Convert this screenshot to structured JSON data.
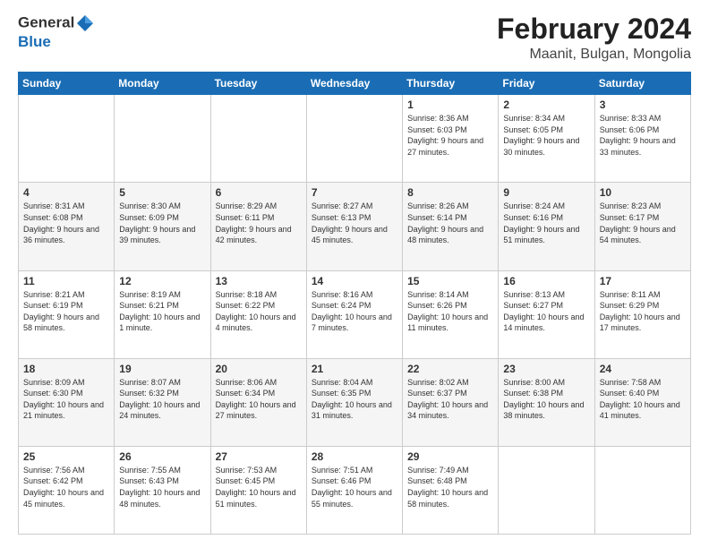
{
  "logo": {
    "line1": "General",
    "line2": "Blue"
  },
  "title": "February 2024",
  "subtitle": "Maanit, Bulgan, Mongolia",
  "days_header": [
    "Sunday",
    "Monday",
    "Tuesday",
    "Wednesday",
    "Thursday",
    "Friday",
    "Saturday"
  ],
  "weeks": [
    [
      {
        "day": "",
        "sunrise": "",
        "sunset": "",
        "daylight": ""
      },
      {
        "day": "",
        "sunrise": "",
        "sunset": "",
        "daylight": ""
      },
      {
        "day": "",
        "sunrise": "",
        "sunset": "",
        "daylight": ""
      },
      {
        "day": "",
        "sunrise": "",
        "sunset": "",
        "daylight": ""
      },
      {
        "day": "1",
        "sunrise": "Sunrise: 8:36 AM",
        "sunset": "Sunset: 6:03 PM",
        "daylight": "Daylight: 9 hours and 27 minutes."
      },
      {
        "day": "2",
        "sunrise": "Sunrise: 8:34 AM",
        "sunset": "Sunset: 6:05 PM",
        "daylight": "Daylight: 9 hours and 30 minutes."
      },
      {
        "day": "3",
        "sunrise": "Sunrise: 8:33 AM",
        "sunset": "Sunset: 6:06 PM",
        "daylight": "Daylight: 9 hours and 33 minutes."
      }
    ],
    [
      {
        "day": "4",
        "sunrise": "Sunrise: 8:31 AM",
        "sunset": "Sunset: 6:08 PM",
        "daylight": "Daylight: 9 hours and 36 minutes."
      },
      {
        "day": "5",
        "sunrise": "Sunrise: 8:30 AM",
        "sunset": "Sunset: 6:09 PM",
        "daylight": "Daylight: 9 hours and 39 minutes."
      },
      {
        "day": "6",
        "sunrise": "Sunrise: 8:29 AM",
        "sunset": "Sunset: 6:11 PM",
        "daylight": "Daylight: 9 hours and 42 minutes."
      },
      {
        "day": "7",
        "sunrise": "Sunrise: 8:27 AM",
        "sunset": "Sunset: 6:13 PM",
        "daylight": "Daylight: 9 hours and 45 minutes."
      },
      {
        "day": "8",
        "sunrise": "Sunrise: 8:26 AM",
        "sunset": "Sunset: 6:14 PM",
        "daylight": "Daylight: 9 hours and 48 minutes."
      },
      {
        "day": "9",
        "sunrise": "Sunrise: 8:24 AM",
        "sunset": "Sunset: 6:16 PM",
        "daylight": "Daylight: 9 hours and 51 minutes."
      },
      {
        "day": "10",
        "sunrise": "Sunrise: 8:23 AM",
        "sunset": "Sunset: 6:17 PM",
        "daylight": "Daylight: 9 hours and 54 minutes."
      }
    ],
    [
      {
        "day": "11",
        "sunrise": "Sunrise: 8:21 AM",
        "sunset": "Sunset: 6:19 PM",
        "daylight": "Daylight: 9 hours and 58 minutes."
      },
      {
        "day": "12",
        "sunrise": "Sunrise: 8:19 AM",
        "sunset": "Sunset: 6:21 PM",
        "daylight": "Daylight: 10 hours and 1 minute."
      },
      {
        "day": "13",
        "sunrise": "Sunrise: 8:18 AM",
        "sunset": "Sunset: 6:22 PM",
        "daylight": "Daylight: 10 hours and 4 minutes."
      },
      {
        "day": "14",
        "sunrise": "Sunrise: 8:16 AM",
        "sunset": "Sunset: 6:24 PM",
        "daylight": "Daylight: 10 hours and 7 minutes."
      },
      {
        "day": "15",
        "sunrise": "Sunrise: 8:14 AM",
        "sunset": "Sunset: 6:26 PM",
        "daylight": "Daylight: 10 hours and 11 minutes."
      },
      {
        "day": "16",
        "sunrise": "Sunrise: 8:13 AM",
        "sunset": "Sunset: 6:27 PM",
        "daylight": "Daylight: 10 hours and 14 minutes."
      },
      {
        "day": "17",
        "sunrise": "Sunrise: 8:11 AM",
        "sunset": "Sunset: 6:29 PM",
        "daylight": "Daylight: 10 hours and 17 minutes."
      }
    ],
    [
      {
        "day": "18",
        "sunrise": "Sunrise: 8:09 AM",
        "sunset": "Sunset: 6:30 PM",
        "daylight": "Daylight: 10 hours and 21 minutes."
      },
      {
        "day": "19",
        "sunrise": "Sunrise: 8:07 AM",
        "sunset": "Sunset: 6:32 PM",
        "daylight": "Daylight: 10 hours and 24 minutes."
      },
      {
        "day": "20",
        "sunrise": "Sunrise: 8:06 AM",
        "sunset": "Sunset: 6:34 PM",
        "daylight": "Daylight: 10 hours and 27 minutes."
      },
      {
        "day": "21",
        "sunrise": "Sunrise: 8:04 AM",
        "sunset": "Sunset: 6:35 PM",
        "daylight": "Daylight: 10 hours and 31 minutes."
      },
      {
        "day": "22",
        "sunrise": "Sunrise: 8:02 AM",
        "sunset": "Sunset: 6:37 PM",
        "daylight": "Daylight: 10 hours and 34 minutes."
      },
      {
        "day": "23",
        "sunrise": "Sunrise: 8:00 AM",
        "sunset": "Sunset: 6:38 PM",
        "daylight": "Daylight: 10 hours and 38 minutes."
      },
      {
        "day": "24",
        "sunrise": "Sunrise: 7:58 AM",
        "sunset": "Sunset: 6:40 PM",
        "daylight": "Daylight: 10 hours and 41 minutes."
      }
    ],
    [
      {
        "day": "25",
        "sunrise": "Sunrise: 7:56 AM",
        "sunset": "Sunset: 6:42 PM",
        "daylight": "Daylight: 10 hours and 45 minutes."
      },
      {
        "day": "26",
        "sunrise": "Sunrise: 7:55 AM",
        "sunset": "Sunset: 6:43 PM",
        "daylight": "Daylight: 10 hours and 48 minutes."
      },
      {
        "day": "27",
        "sunrise": "Sunrise: 7:53 AM",
        "sunset": "Sunset: 6:45 PM",
        "daylight": "Daylight: 10 hours and 51 minutes."
      },
      {
        "day": "28",
        "sunrise": "Sunrise: 7:51 AM",
        "sunset": "Sunset: 6:46 PM",
        "daylight": "Daylight: 10 hours and 55 minutes."
      },
      {
        "day": "29",
        "sunrise": "Sunrise: 7:49 AM",
        "sunset": "Sunset: 6:48 PM",
        "daylight": "Daylight: 10 hours and 58 minutes."
      },
      {
        "day": "",
        "sunrise": "",
        "sunset": "",
        "daylight": ""
      },
      {
        "day": "",
        "sunrise": "",
        "sunset": "",
        "daylight": ""
      }
    ]
  ]
}
